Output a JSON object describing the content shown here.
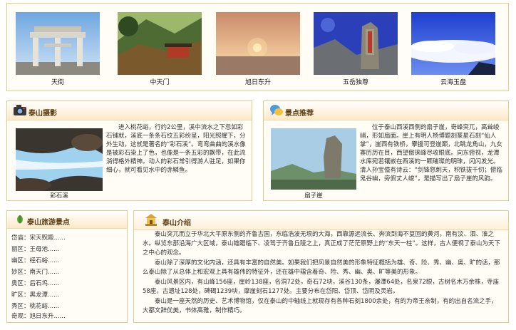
{
  "gallery": {
    "items": [
      {
        "caption": "天街",
        "icon": "paifang-gate-photo"
      },
      {
        "caption": "中天门",
        "icon": "mountain-gate-photo"
      },
      {
        "caption": "旭日东升",
        "icon": "sunrise-photo"
      },
      {
        "caption": "五岳独尊",
        "icon": "stone-tablet-photo"
      },
      {
        "caption": "云海玉盘",
        "icon": "sea-of-clouds-photo"
      }
    ]
  },
  "photo_box": {
    "title": "泰山摄影",
    "icon": "camera-icon",
    "text": "进入桃花峪，行约2公里，溪中流水之下忽如彩石铺就，溪底一条条石纹五彩纷呈，阳光照耀下，分外生动，这就是著名的“彩石溪”。弯弯曲曲的溪水像是被彩石染上了色，也像是一条五彩的飘带，在此流淌得格外精神。动人的彩石常引得游人驻足，如果你细心，就可看见水中的赤鳞鱼。",
    "image_caption": "彩石溪"
  },
  "spot_box": {
    "title": "景点推荐",
    "icon": "speech-bubble-icon",
    "text": "位于泰山西溪西侧的扇子崖，奇峰突兀，高耸峻峭，形如扇面。崖上有明人杨博题刻篆星石刻“仙人掌”，崖西有铁桥，攀援可登崖巅，北眺龙角山，九女寨历历在目，西望傲徕峰尽收眼底。向东俯视，龙潭水库宛若镶嵌在西溪的一颗璀璨的明珠，闪闪发光。清人孙宝僮有诗云：“剑锋怒刺天，积铁拔千仞；俯临鬼谷幽，旁俯丈人峻”，是描写出了扇子崖的风韵。",
    "image_caption": "扇子崖"
  },
  "sidebar": {
    "title": "泰山旅游景点",
    "icon": "star-leaf-icon",
    "items": [
      "岱庙：宋天贶殿......",
      "丽区：王母池......",
      "幽区：经石峪......",
      "妙区：南天门......",
      "奥区：后石坞......",
      "旷区：黑龙潭......",
      "秀区：桃花峪......",
      "奇观：旭日东升......"
    ]
  },
  "intro": {
    "title": "泰山介绍",
    "icon": "temple-icon",
    "paragraphs": [
      "泰山突兀而立于华北大平原东侧的齐鲁古国，东临浩波无垠的大海，西靠源远流长、奔流到海不复回的黄河，南有汶、泗、淮之水。纵览东部沿海广大区域，泰山雄踞临下、凌驾于齐鲁丘陵之上，真正成了茫茫原野上的“东天一柱”。这样，古人便视了泰山为天下之中心的观念。",
      "泰山除了深厚的文化内涵，还具有丰富的自然美。如果我们把风景自然美的形象特征概括为雄、奇、险、秀、幽、奥、旷的话，那么泰山除了从总体上和宏观上具有雄伟的特征外，还在雄中蕴含着奇、险、秀、幽、奥、旷等美的形象。",
      "泰山风景区内，有山峰156座，崖岭138座，名洞72处，奇石72块，溪谷130条，瀑潭64处，名泉72眼，古树名木万余株，寺庙58座，古遗址128处，碑碣1239块，摩崖刻石1277处。主要分布在岱阳、岱顶、岱阴及灵岩。",
      "泰山是一座天然的历史、艺术博物馆，仅在泰山的中轴线上就现存有各种石刻1800余处，有的为帝王亲制，有的出自名流之手，大都文辞优美，书体高雅，制作精巧。"
    ]
  }
}
